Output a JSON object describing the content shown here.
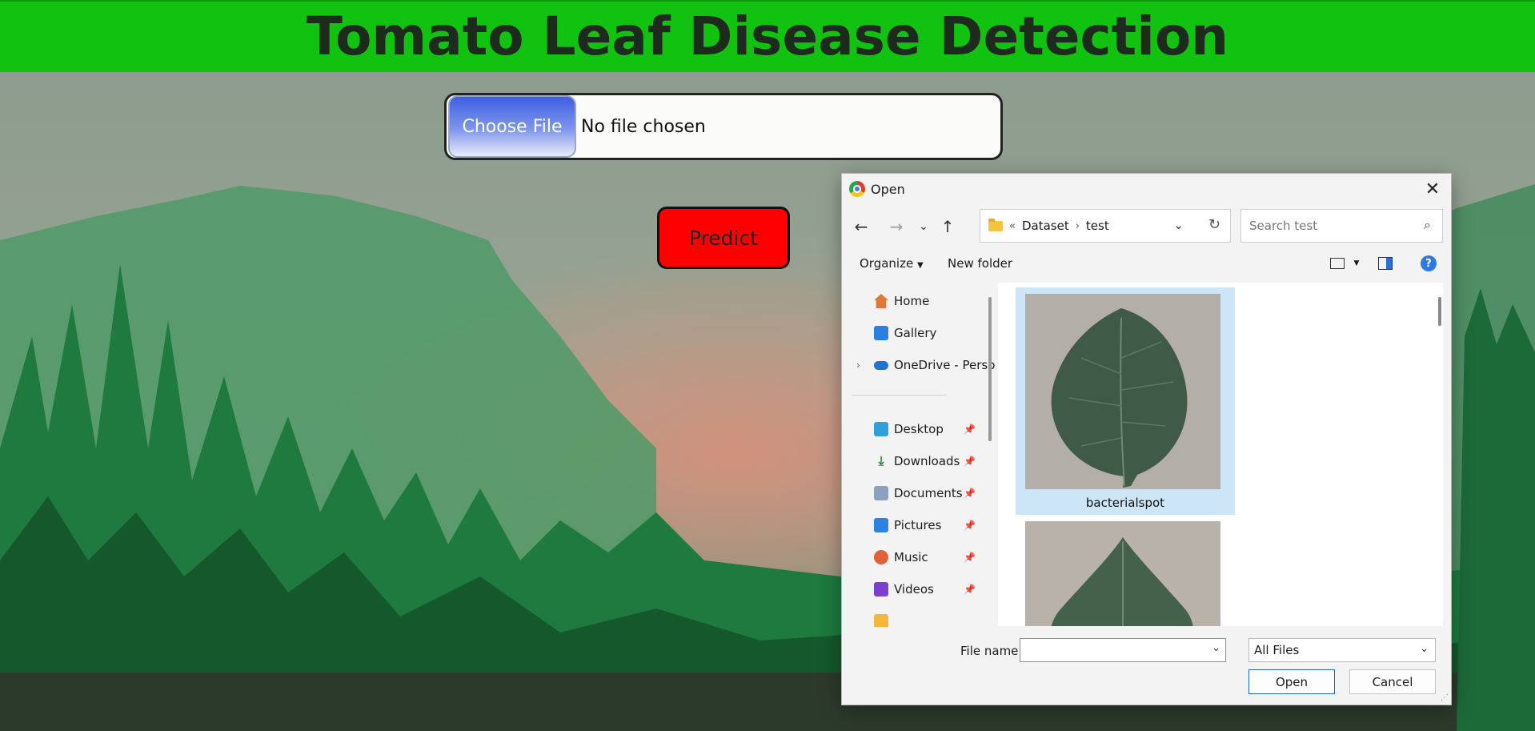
{
  "page": {
    "title": "Tomato Leaf Disease Detection",
    "file_input": {
      "button_label": "Choose File",
      "status": "No file chosen"
    },
    "predict_label": "Predict"
  },
  "colors": {
    "header_green": "#11c211",
    "predict_red": "#ff0000",
    "choose_blue": "#3f5fe0",
    "dialog_bg": "#f3f3f3",
    "selection_blue": "#cde6f7"
  },
  "dialog": {
    "title": "Open",
    "close_icon": "close-icon",
    "nav": {
      "back_icon": "back-arrow-icon",
      "forward_icon": "forward-arrow-icon",
      "recent_icon": "chevron-down-icon",
      "up_icon": "up-arrow-icon"
    },
    "address": {
      "overflow": "«",
      "crumbs": [
        "Dataset",
        "test"
      ]
    },
    "search_placeholder": "Search test",
    "toolbar": {
      "organize": "Organize",
      "new_folder": "New folder"
    },
    "sidebar": {
      "quick": [
        {
          "label": "Home",
          "icon": "home-icon"
        },
        {
          "label": "Gallery",
          "icon": "gallery-icon"
        },
        {
          "label": "OneDrive - Perso",
          "icon": "onedrive-icon"
        }
      ],
      "pinned": [
        {
          "label": "Desktop",
          "icon": "desktop-icon"
        },
        {
          "label": "Downloads",
          "icon": "downloads-icon"
        },
        {
          "label": "Documents",
          "icon": "documents-icon"
        },
        {
          "label": "Pictures",
          "icon": "pictures-icon"
        },
        {
          "label": "Music",
          "icon": "music-icon"
        },
        {
          "label": "Videos",
          "icon": "videos-icon"
        }
      ]
    },
    "files": [
      {
        "name": "bacterialspot",
        "selected": true
      },
      {
        "name": "",
        "selected": false
      }
    ],
    "file_name_label": "File name:",
    "file_name_value": "",
    "file_type": "All Files",
    "open_label": "Open",
    "cancel_label": "Cancel"
  }
}
